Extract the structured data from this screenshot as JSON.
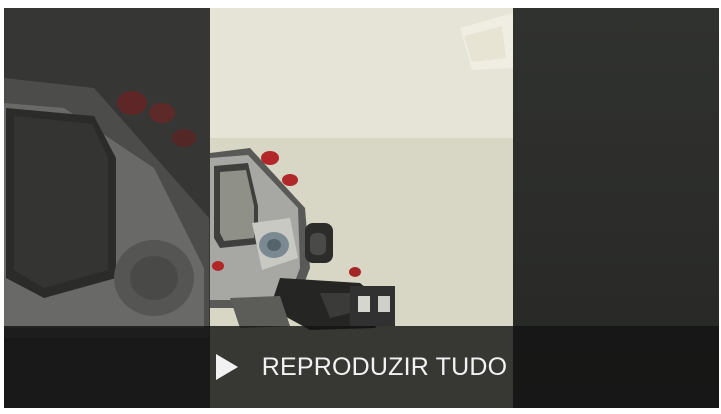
{
  "player": {
    "thumbnail_icon": "robot-video-thumbnail",
    "play_all_label": "REPRODUZIR TUDO",
    "play_icon": "play-icon",
    "colors": {
      "overlay": "#141414",
      "label": "#f2f2f2",
      "frame_background": "#dad8c8",
      "side_background": "#2c2d2b"
    }
  }
}
